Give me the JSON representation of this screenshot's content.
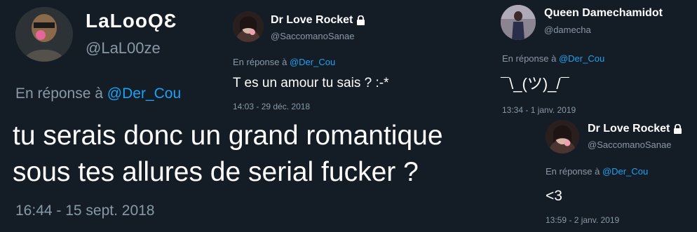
{
  "tweets": [
    {
      "display_name": "LaLooǪƐ",
      "handle": "@LaL00ze",
      "reply_prefix": "En réponse à",
      "reply_to": "@Der_Cou",
      "text_lines": [
        "tu serais donc un grand romantique",
        "sous tes allures de serial fucker ?"
      ],
      "timestamp": "16:44 - 15 sept. 2018",
      "protected": false
    },
    {
      "display_name": "Dr Love Rocket",
      "handle": "@SaccomanoSanae",
      "reply_prefix": "En réponse à",
      "reply_to": "@Der_Cou",
      "text": "T es un amour tu sais ? :-*",
      "timestamp": "14:03 - 29 déc. 2018",
      "protected": true
    },
    {
      "display_name": "Queen Damechamidot",
      "handle": "@damecha",
      "reply_prefix": "En réponse à",
      "reply_to": "@Der_Cou",
      "text": "¯\\_(ツ)_/¯",
      "timestamp": "13:34 - 1 janv. 2019",
      "protected": false
    },
    {
      "display_name": "Dr Love Rocket",
      "handle": "@SaccomanoSanae",
      "reply_prefix": "En réponse à",
      "reply_to": "@Der_Cou",
      "text": "<3",
      "timestamp": "13:59 - 2 janv. 2019",
      "protected": true
    }
  ],
  "colors": {
    "background": "#141d26",
    "text": "#ffffff",
    "secondary": "#8899a6",
    "mention": "#1da1f2"
  },
  "icons": [
    "lock-icon"
  ]
}
